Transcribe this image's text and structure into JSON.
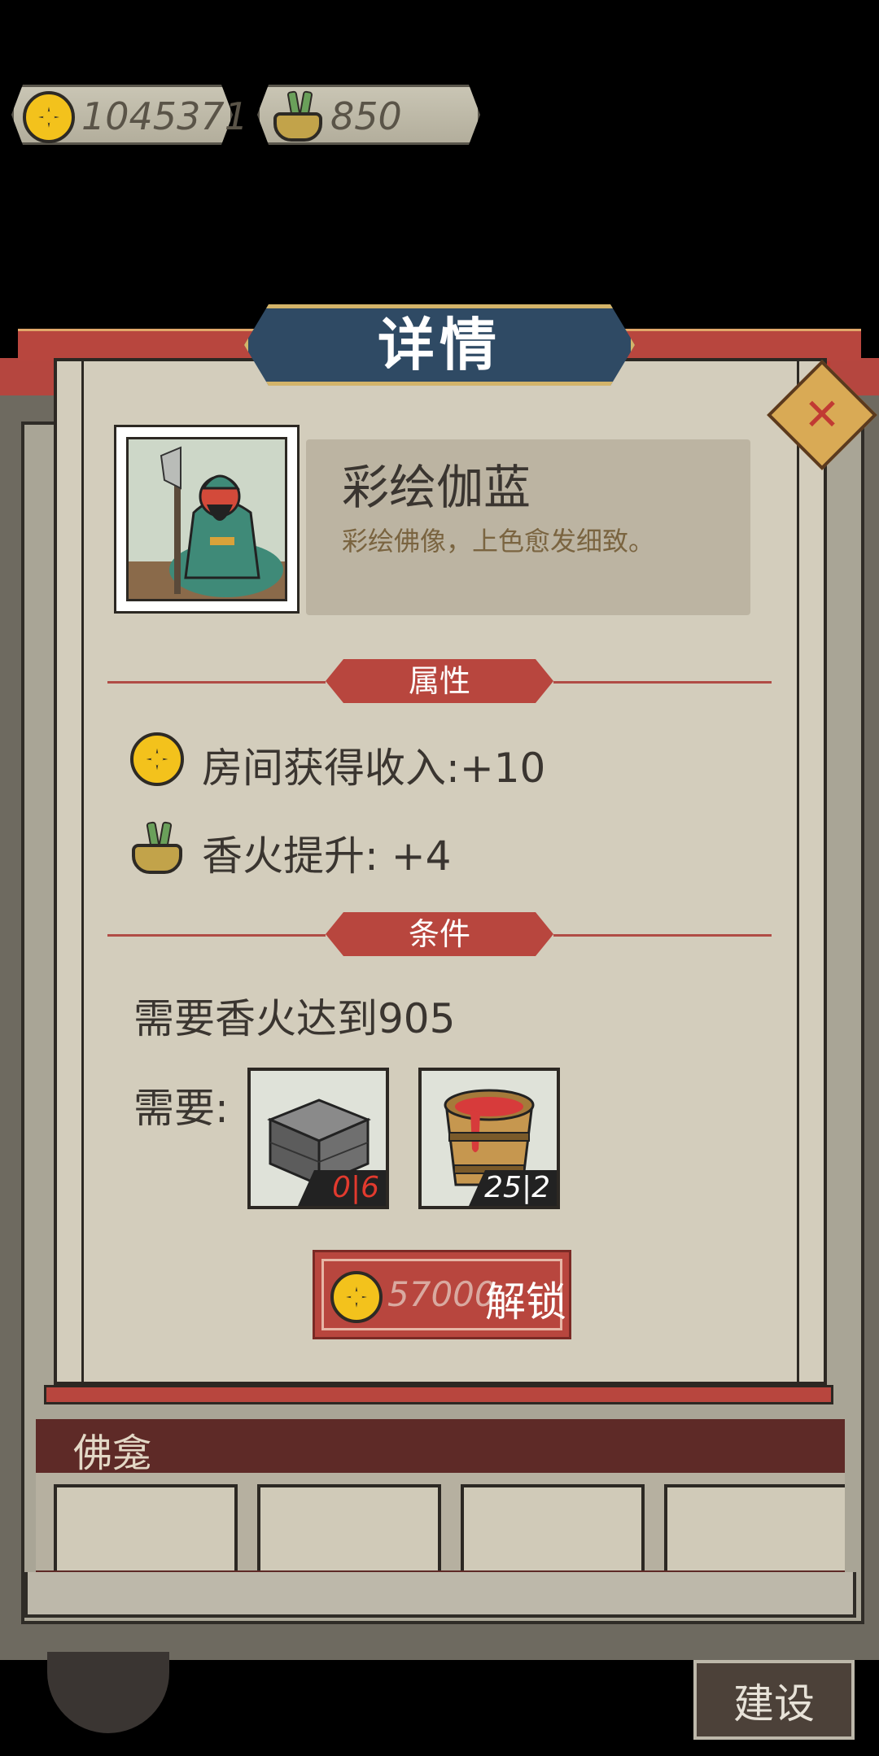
{
  "currency": {
    "coins": "1045371",
    "incense": "850"
  },
  "dialog": {
    "title": "详情",
    "close_icon": "close-x-icon"
  },
  "item": {
    "name": "彩绘伽蓝",
    "description": "彩绘佛像，上色愈发细致。",
    "portrait_icon": "guan-yu-statue-icon"
  },
  "attributes": {
    "section_label": "属性",
    "income_text": "房间获得收入:+10",
    "incense_text": "香火提升:  +4"
  },
  "conditions": {
    "section_label": "条件",
    "requirement_text": "需要香火达到905",
    "need_label": "需要:",
    "materials": [
      {
        "icon": "stone-brick-icon",
        "count": "0|6",
        "count_color": "#e23a2e"
      },
      {
        "icon": "red-paint-bucket-icon",
        "count": "25|2",
        "count_color": "#ffffff"
      }
    ]
  },
  "unlock": {
    "price": "57000",
    "label": "解锁"
  },
  "shrine_list": {
    "title": "佛龛"
  },
  "bottom_nav": {
    "build_label": "建设"
  },
  "colors": {
    "coin": "#f3c21c",
    "accent_red": "#b8463e",
    "banner_blue": "#2f4a64",
    "parchment": "#d3cdbc"
  }
}
